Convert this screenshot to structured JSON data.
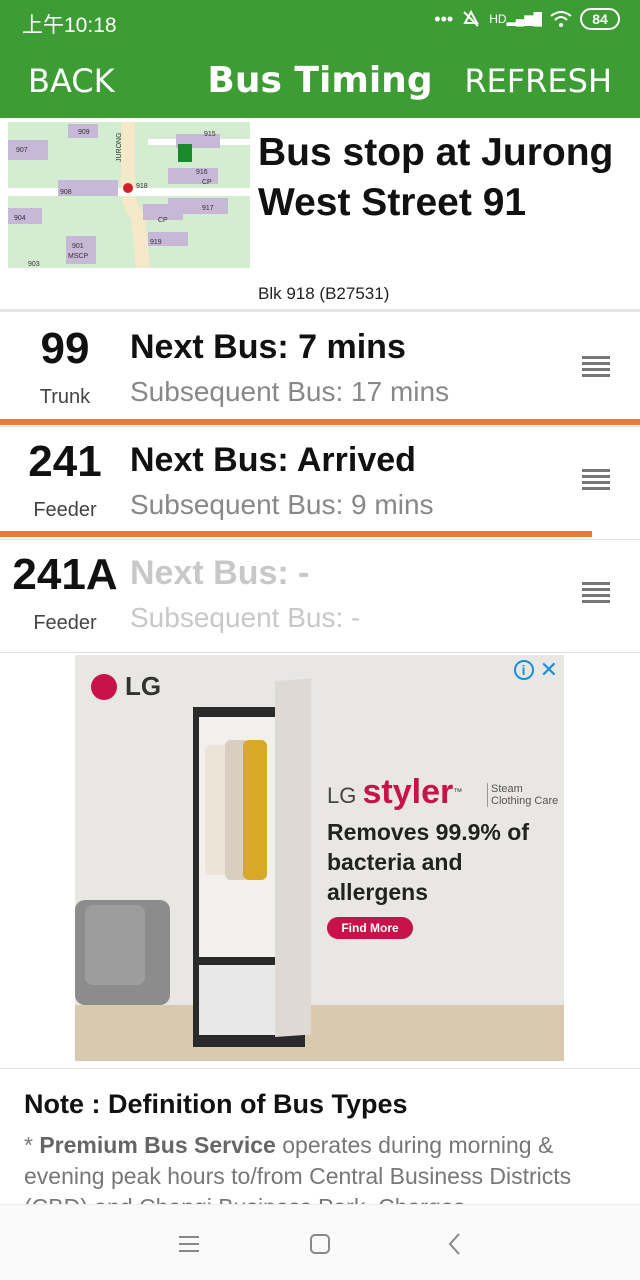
{
  "status_bar": {
    "time": "上午10:18",
    "icons": [
      "more-dots-icon",
      "mute-icon",
      "hd-signal-icon",
      "wifi-icon"
    ],
    "hd_label": "HD",
    "battery": "84"
  },
  "app_bar": {
    "back_label": "BACK",
    "title": "Bus Timing",
    "refresh_label": "REFRESH",
    "color": "#3e9c35"
  },
  "bus_stop": {
    "name": "Bus stop at Jurong West Street 91",
    "code": "Blk 918 (B27531)",
    "map_labels": [
      "909",
      "915",
      "907",
      "916",
      "908",
      "918",
      "917",
      "904",
      "901",
      "919",
      "903",
      "JURONG",
      "MSCP",
      "CP"
    ]
  },
  "services": [
    {
      "number": "99",
      "type": "Trunk",
      "next": "Next Bus: 7 mins",
      "subsequent": "Subsequent Bus: 17 mins"
    },
    {
      "number": "241",
      "type": "Feeder",
      "next": "Next Bus: Arrived",
      "subsequent": "Subsequent Bus: 9 mins"
    },
    {
      "number": "241A",
      "type": "Feeder",
      "next": "Next Bus: -",
      "subsequent": "Subsequent Bus: -"
    }
  ],
  "accent_color": "#f47a2b",
  "ad": {
    "logo": "LG",
    "brand_prefix": "LG",
    "brand": "styler",
    "trademark": "™",
    "brand_sub": "Steam Clothing Care",
    "copy": "Removes 99.9% of bacteria and allergens",
    "cta": "Find More"
  },
  "note": {
    "title": "Note : Definition of Bus Types",
    "bullet": "*",
    "bold_term": "Premium Bus Service",
    "body": " operates during morning & evening peak hours to/from Central Business Districts (CBD) and Changi Business Park. Charges"
  }
}
